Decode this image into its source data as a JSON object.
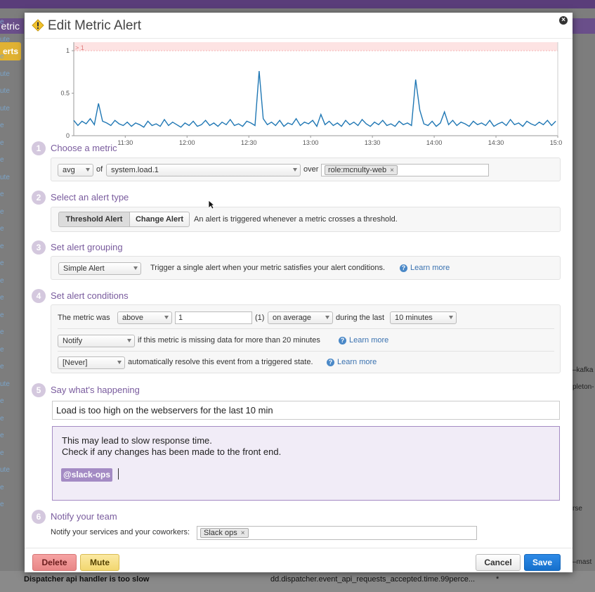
{
  "background": {
    "tab_label": "etric",
    "button_label": "erts",
    "left_rows": [
      "e",
      "ute",
      "e",
      "ute",
      "ute",
      "ute",
      "e",
      "e",
      "e",
      "ute",
      "e",
      "e",
      "e",
      "e",
      "e",
      "e",
      "e",
      "e",
      "e",
      "e",
      "e",
      "ute",
      "e",
      "e",
      "e",
      "e",
      "ute",
      "e",
      "e"
    ],
    "right_snippets": [
      "–kafka",
      "pleton-",
      "rse",
      "–mast"
    ],
    "bottom_alert_name": "Dispatcher api handler is too slow",
    "bottom_metric": "dd.dispatcher.event_api_requests_accepted.time.99perce...",
    "bottom_star": "*"
  },
  "modal": {
    "title": "Edit Metric Alert",
    "close_label": "×"
  },
  "chart_data": {
    "type": "line",
    "threshold_label": "> 1",
    "threshold": 1,
    "ylim": [
      0,
      1.1
    ],
    "yticks": [
      "1",
      "0.5",
      "0"
    ],
    "xticks": [
      "11:30",
      "12:00",
      "12:30",
      "13:00",
      "13:30",
      "14:00",
      "14:30",
      "15:00"
    ],
    "x_start": "11:05",
    "x_end": "15:00",
    "series": [
      {
        "color": "#1f77b4",
        "x": [
          "11:05",
          "11:07",
          "11:09",
          "11:11",
          "11:13",
          "11:15",
          "11:17",
          "11:19",
          "11:21",
          "11:23",
          "11:25",
          "11:27",
          "11:29",
          "11:31",
          "11:33",
          "11:35",
          "11:37",
          "11:39",
          "11:41",
          "11:43",
          "11:45",
          "11:47",
          "11:49",
          "11:51",
          "11:53",
          "11:55",
          "11:57",
          "11:59",
          "12:01",
          "12:03",
          "12:05",
          "12:07",
          "12:09",
          "12:11",
          "12:13",
          "12:15",
          "12:17",
          "12:19",
          "12:21",
          "12:23",
          "12:25",
          "12:27",
          "12:29",
          "12:31",
          "12:33",
          "12:35",
          "12:37",
          "12:39",
          "12:41",
          "12:43",
          "12:45",
          "12:47",
          "12:49",
          "12:51",
          "12:53",
          "12:55",
          "12:57",
          "12:59",
          "13:01",
          "13:03",
          "13:05",
          "13:07",
          "13:09",
          "13:11",
          "13:13",
          "13:15",
          "13:17",
          "13:19",
          "13:21",
          "13:23",
          "13:25",
          "13:27",
          "13:29",
          "13:31",
          "13:33",
          "13:35",
          "13:37",
          "13:39",
          "13:41",
          "13:43",
          "13:45",
          "13:47",
          "13:49",
          "13:51",
          "13:53",
          "13:55",
          "13:57",
          "13:59",
          "14:01",
          "14:03",
          "14:05",
          "14:07",
          "14:09",
          "14:11",
          "14:13",
          "14:15",
          "14:17",
          "14:19",
          "14:21",
          "14:23",
          "14:25",
          "14:27",
          "14:29",
          "14:31",
          "14:33",
          "14:35",
          "14:37",
          "14:39",
          "14:41",
          "14:43",
          "14:45",
          "14:47",
          "14:49",
          "14:51",
          "14:53",
          "14:55",
          "14:57",
          "14:59"
        ],
        "values": [
          0.18,
          0.12,
          0.17,
          0.14,
          0.2,
          0.13,
          0.38,
          0.17,
          0.15,
          0.12,
          0.18,
          0.14,
          0.12,
          0.16,
          0.11,
          0.15,
          0.13,
          0.1,
          0.17,
          0.12,
          0.14,
          0.11,
          0.19,
          0.12,
          0.16,
          0.13,
          0.1,
          0.15,
          0.12,
          0.17,
          0.11,
          0.13,
          0.18,
          0.12,
          0.15,
          0.11,
          0.16,
          0.13,
          0.19,
          0.12,
          0.14,
          0.11,
          0.17,
          0.15,
          0.12,
          0.76,
          0.2,
          0.13,
          0.16,
          0.12,
          0.18,
          0.11,
          0.15,
          0.13,
          0.2,
          0.12,
          0.16,
          0.14,
          0.18,
          0.11,
          0.25,
          0.13,
          0.17,
          0.12,
          0.15,
          0.11,
          0.18,
          0.13,
          0.16,
          0.12,
          0.19,
          0.14,
          0.11,
          0.16,
          0.13,
          0.18,
          0.12,
          0.14,
          0.11,
          0.17,
          0.13,
          0.15,
          0.12,
          0.66,
          0.3,
          0.14,
          0.12,
          0.17,
          0.11,
          0.15,
          0.28,
          0.13,
          0.18,
          0.12,
          0.16,
          0.14,
          0.11,
          0.17,
          0.13,
          0.15,
          0.12,
          0.18,
          0.11,
          0.14,
          0.16,
          0.12,
          0.19,
          0.13,
          0.15,
          0.11,
          0.17,
          0.14,
          0.12,
          0.16,
          0.13,
          0.18,
          0.12,
          0.17
        ]
      }
    ]
  },
  "steps": {
    "s1": {
      "num": "1",
      "title": "Choose a metric",
      "agg": "avg",
      "of_label": "of",
      "metric": "system.load.1",
      "over_label": "over",
      "scope_token": "role:mcnulty-web"
    },
    "s2": {
      "num": "2",
      "title": "Select an alert type",
      "threshold_btn": "Threshold Alert",
      "change_btn": "Change Alert",
      "description": "An alert is triggered whenever a metric crosses a threshold."
    },
    "s3": {
      "num": "3",
      "title": "Set alert grouping",
      "grouping": "Simple Alert",
      "description": "Trigger a single alert when your metric satisfies your alert conditions.",
      "learn_more": "Learn more"
    },
    "s4": {
      "num": "4",
      "title": "Set alert conditions",
      "metric_was": "The metric was",
      "comparator": "above",
      "threshold_value": "1",
      "threshold_unit": "(1)",
      "aggregation": "on average",
      "during_label": "during the last",
      "window": "10 minutes",
      "missing_option": "Notify",
      "missing_text": "if this metric is missing data for more than 20 minutes",
      "missing_learn": "Learn more",
      "resolve_option": "[Never]",
      "resolve_text": "automatically resolve this event from a triggered state.",
      "resolve_learn": "Learn more"
    },
    "s5": {
      "num": "5",
      "title": "Say what's happening",
      "message_title": "Load is too high on the webservers for the last 10 min",
      "body_line1": "This may lead to slow response time.",
      "body_line2": "Check if any changes has been made to the front end.",
      "mention": "@slack-ops"
    },
    "s6": {
      "num": "6",
      "title": "Notify your team",
      "label": "Notify your services and your coworkers:",
      "token": "Slack ops"
    }
  },
  "footer": {
    "delete": "Delete",
    "mute": "Mute",
    "cancel": "Cancel",
    "save": "Save"
  },
  "colors": {
    "accent": "#7a5c9e",
    "save": "#1670cc",
    "delete": "#e88686",
    "mute": "#f2d770",
    "threshold_band": "#fde3e3",
    "series": "#1f77b4"
  }
}
